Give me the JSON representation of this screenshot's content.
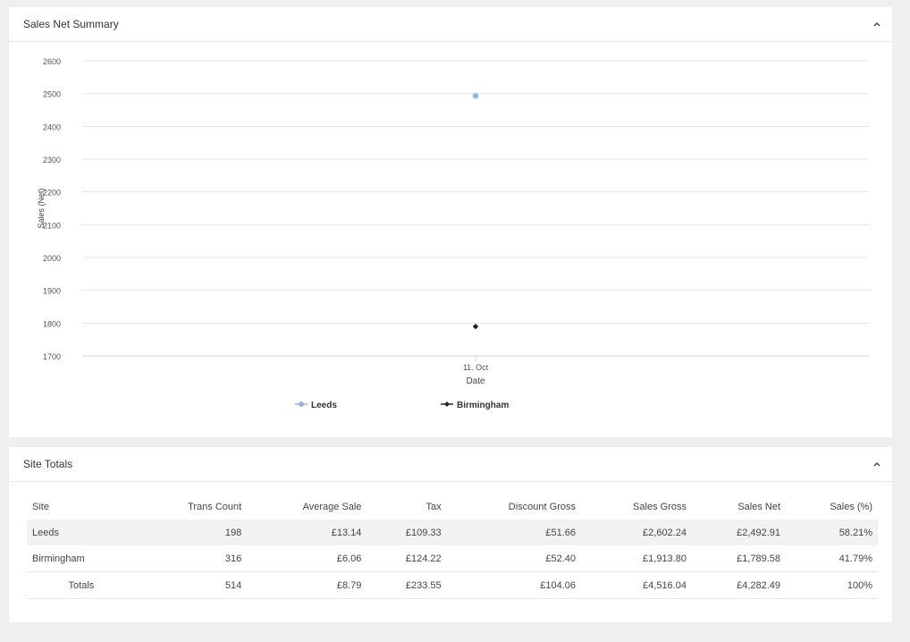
{
  "chart_panel": {
    "title": "Sales Net Summary",
    "toggle_icon": "chevron-up-icon"
  },
  "chart_data": {
    "type": "scatter",
    "xlabel": "Date",
    "ylabel": "Sales (Net)",
    "categories": [
      "11. Oct"
    ],
    "y_ticks": [
      1700,
      1800,
      1900,
      2000,
      2100,
      2200,
      2300,
      2400,
      2500,
      2600
    ],
    "ylim": [
      1700,
      2600
    ],
    "grid": true,
    "legend_position": "bottom",
    "series": [
      {
        "name": "Leeds",
        "values": [
          2492.91
        ],
        "color": "#8fb5e6",
        "marker": "circle"
      },
      {
        "name": "Birmingham",
        "values": [
          1789.58
        ],
        "color": "#222222",
        "marker": "diamond"
      }
    ]
  },
  "table_panel": {
    "title": "Site Totals",
    "toggle_icon": "chevron-up-icon",
    "columns": [
      "Site",
      "Trans Count",
      "Average Sale",
      "Tax",
      "Discount Gross",
      "Sales Gross",
      "Sales Net",
      "Sales (%)"
    ],
    "rows": [
      [
        "Leeds",
        "198",
        "£13.14",
        "£109.33",
        "£51.66",
        "£2,602.24",
        "£2,492.91",
        "58.21%"
      ],
      [
        "Birmingham",
        "316",
        "£6.06",
        "£124.22",
        "£52.40",
        "£1,913.80",
        "£1,789.58",
        "41.79%"
      ]
    ],
    "totals": [
      "Totals",
      "514",
      "£8.79",
      "£233.55",
      "£104.06",
      "£4,516.04",
      "£4,282.49",
      "100%"
    ]
  }
}
